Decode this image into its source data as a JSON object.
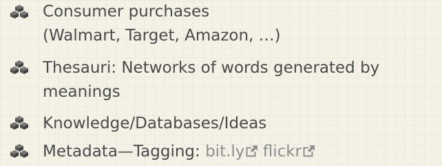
{
  "bullets": [
    {
      "line1": "Consumer purchases",
      "line2": "(Walmart, Target, Amazon, …)"
    },
    {
      "line1": "Thesauri: Networks of words generated by",
      "line2": "meanings"
    },
    {
      "line1": "Knowledge/Databases/Ideas"
    },
    {
      "prefix": "Metadata—Tagging: ",
      "links": [
        "bit.ly",
        "flickr"
      ]
    }
  ],
  "icon_name": "cubes-icon",
  "colors": {
    "background": "#f4f1e6",
    "text": "#4a4a4a",
    "link": "#8e8e8e",
    "icon_fill": "#555555"
  }
}
